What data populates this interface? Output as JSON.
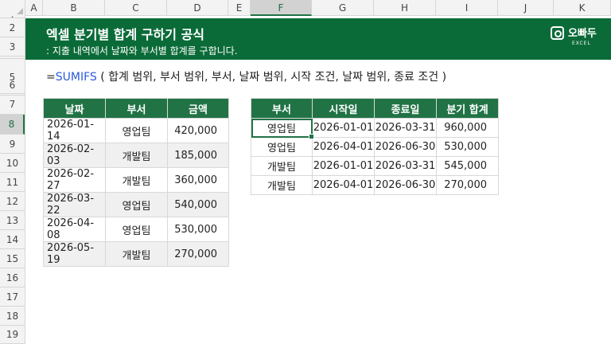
{
  "columns": [
    "A",
    "B",
    "C",
    "D",
    "E",
    "F",
    "G",
    "H",
    "I",
    "J",
    "K"
  ],
  "rows": [
    "1",
    "2",
    "3",
    "5",
    "6",
    "7",
    "8",
    "9",
    "10",
    "11",
    "12",
    "13",
    "14",
    "15",
    "16",
    "17",
    "18",
    "19"
  ],
  "selected_col": "F",
  "selected_row": "8",
  "banner": {
    "title": "엑셀 분기별 합계 구하기 공식",
    "subtitle": ": 지출 내역에서 날짜와 부서별 합계를 구합니다.",
    "brand_name": "오빠두",
    "brand_sub": "EXCEL"
  },
  "formula": {
    "equals": "=",
    "function": "SUMIFS",
    "args": " ( 합계 범위, 부서 범위, 부서, 날짜 범위, 시작 조건, 날짜 범위, 종료 조건 )"
  },
  "table1": {
    "headers": [
      "날짜",
      "부서",
      "금액"
    ],
    "rows": [
      [
        "2026-01-14",
        "영업팀",
        "420,000"
      ],
      [
        "2026-02-03",
        "개발팀",
        "185,000"
      ],
      [
        "2026-02-27",
        "개발팀",
        "360,000"
      ],
      [
        "2026-03-22",
        "영업팀",
        "540,000"
      ],
      [
        "2026-04-08",
        "영업팀",
        "530,000"
      ],
      [
        "2026-05-19",
        "개발팀",
        "270,000"
      ]
    ]
  },
  "table2": {
    "headers": [
      "부서",
      "시작일",
      "종료일",
      "분기 합계"
    ],
    "rows": [
      [
        "영업팀",
        "2026-01-01",
        "2026-03-31",
        "960,000"
      ],
      [
        "영업팀",
        "2026-04-01",
        "2026-06-30",
        "530,000"
      ],
      [
        "개발팀",
        "2026-01-01",
        "2026-03-31",
        "545,000"
      ],
      [
        "개발팀",
        "2026-04-01",
        "2026-06-30",
        "270,000"
      ]
    ]
  },
  "colors": {
    "header_green": "#217346",
    "banner_green": "#0b6b38",
    "function_blue": "#2a5bd7"
  }
}
